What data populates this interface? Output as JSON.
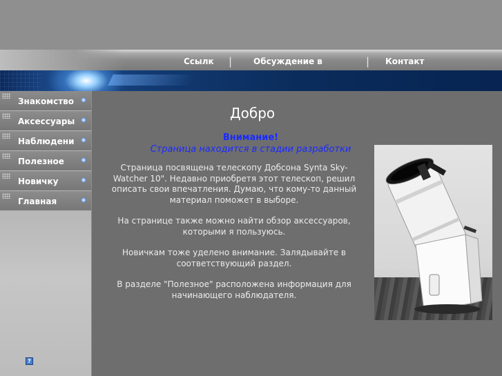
{
  "nav": {
    "links": [
      "Ссылк",
      "Обсуждение в",
      "Контакт"
    ],
    "separator": "|"
  },
  "sidebar": {
    "items": [
      {
        "label": "Знакомство"
      },
      {
        "label": "Аксессуары"
      },
      {
        "label": "Наблюдени"
      },
      {
        "label": "Полезное"
      },
      {
        "label": "Новичку"
      },
      {
        "label": "Главная"
      }
    ],
    "help_icon": "?"
  },
  "main": {
    "title": "Добро",
    "attention": "Внимание!",
    "dev_note": "Страница находится в стадии разработки",
    "paragraphs": [
      "Страница посвящена телескопу Добсона Synta Sky-Watcher 10\". Недавно приобретя этот телескоп, решил описать свои впечатления. Думаю, что кому-то данный материал поможет в выборе.",
      "На странице также можно найти обзор аксессуаров, которыми я пользуюсь.",
      "Новичкам тоже уделено внимание. Залядывайте в соответствующий раздел.",
      "В разделе \"Полезное\" расположена информация для начинающего наблюдателя."
    ]
  },
  "colors": {
    "accent_blue": "#1a2bff",
    "content_bg": "#6e6e6e",
    "banner_blue": "#0b2a5e"
  }
}
